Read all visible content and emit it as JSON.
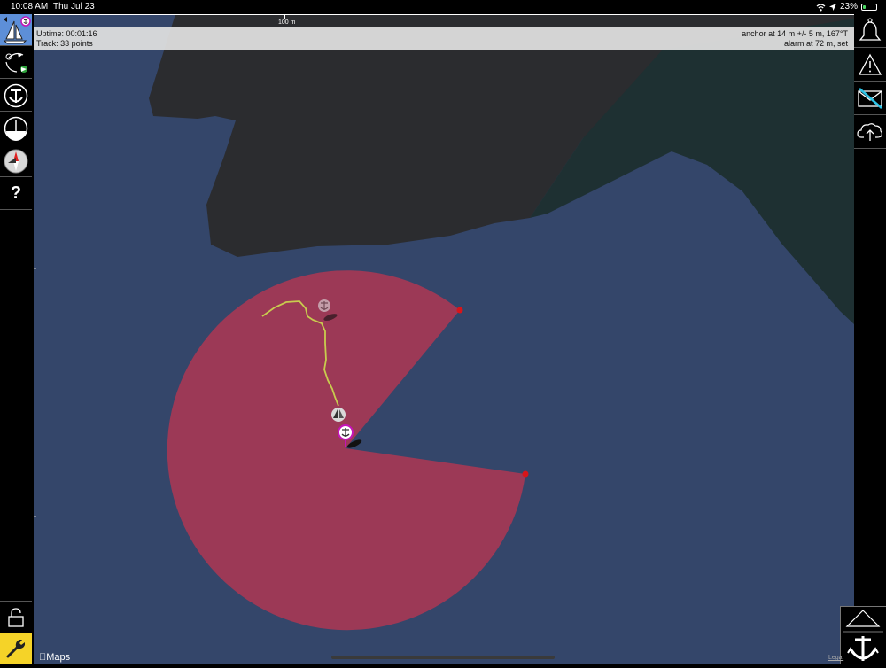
{
  "status_bar": {
    "time": "10:08 AM",
    "date": "Thu Jul 23",
    "battery": "23%",
    "battery_level": 0.23
  },
  "scale": {
    "label": "100 m"
  },
  "info": {
    "uptime": "Uptime: 00:01:16",
    "track": "Track: 33 points",
    "anchor": "anchor at 14 m +/- 5 m, 167°T",
    "alarm": "alarm at 72 m, set"
  },
  "map": {
    "attribution": "Maps",
    "legal": "Legal"
  },
  "left_toolbar": {
    "help_label": "?"
  },
  "colors": {
    "water": "#34466a",
    "land": "#2b2c2f",
    "land_green": "#1e3032",
    "alarm_zone": "#9c3956",
    "track": "#c8cc4e",
    "toolbar_accent": "#f5d328"
  }
}
